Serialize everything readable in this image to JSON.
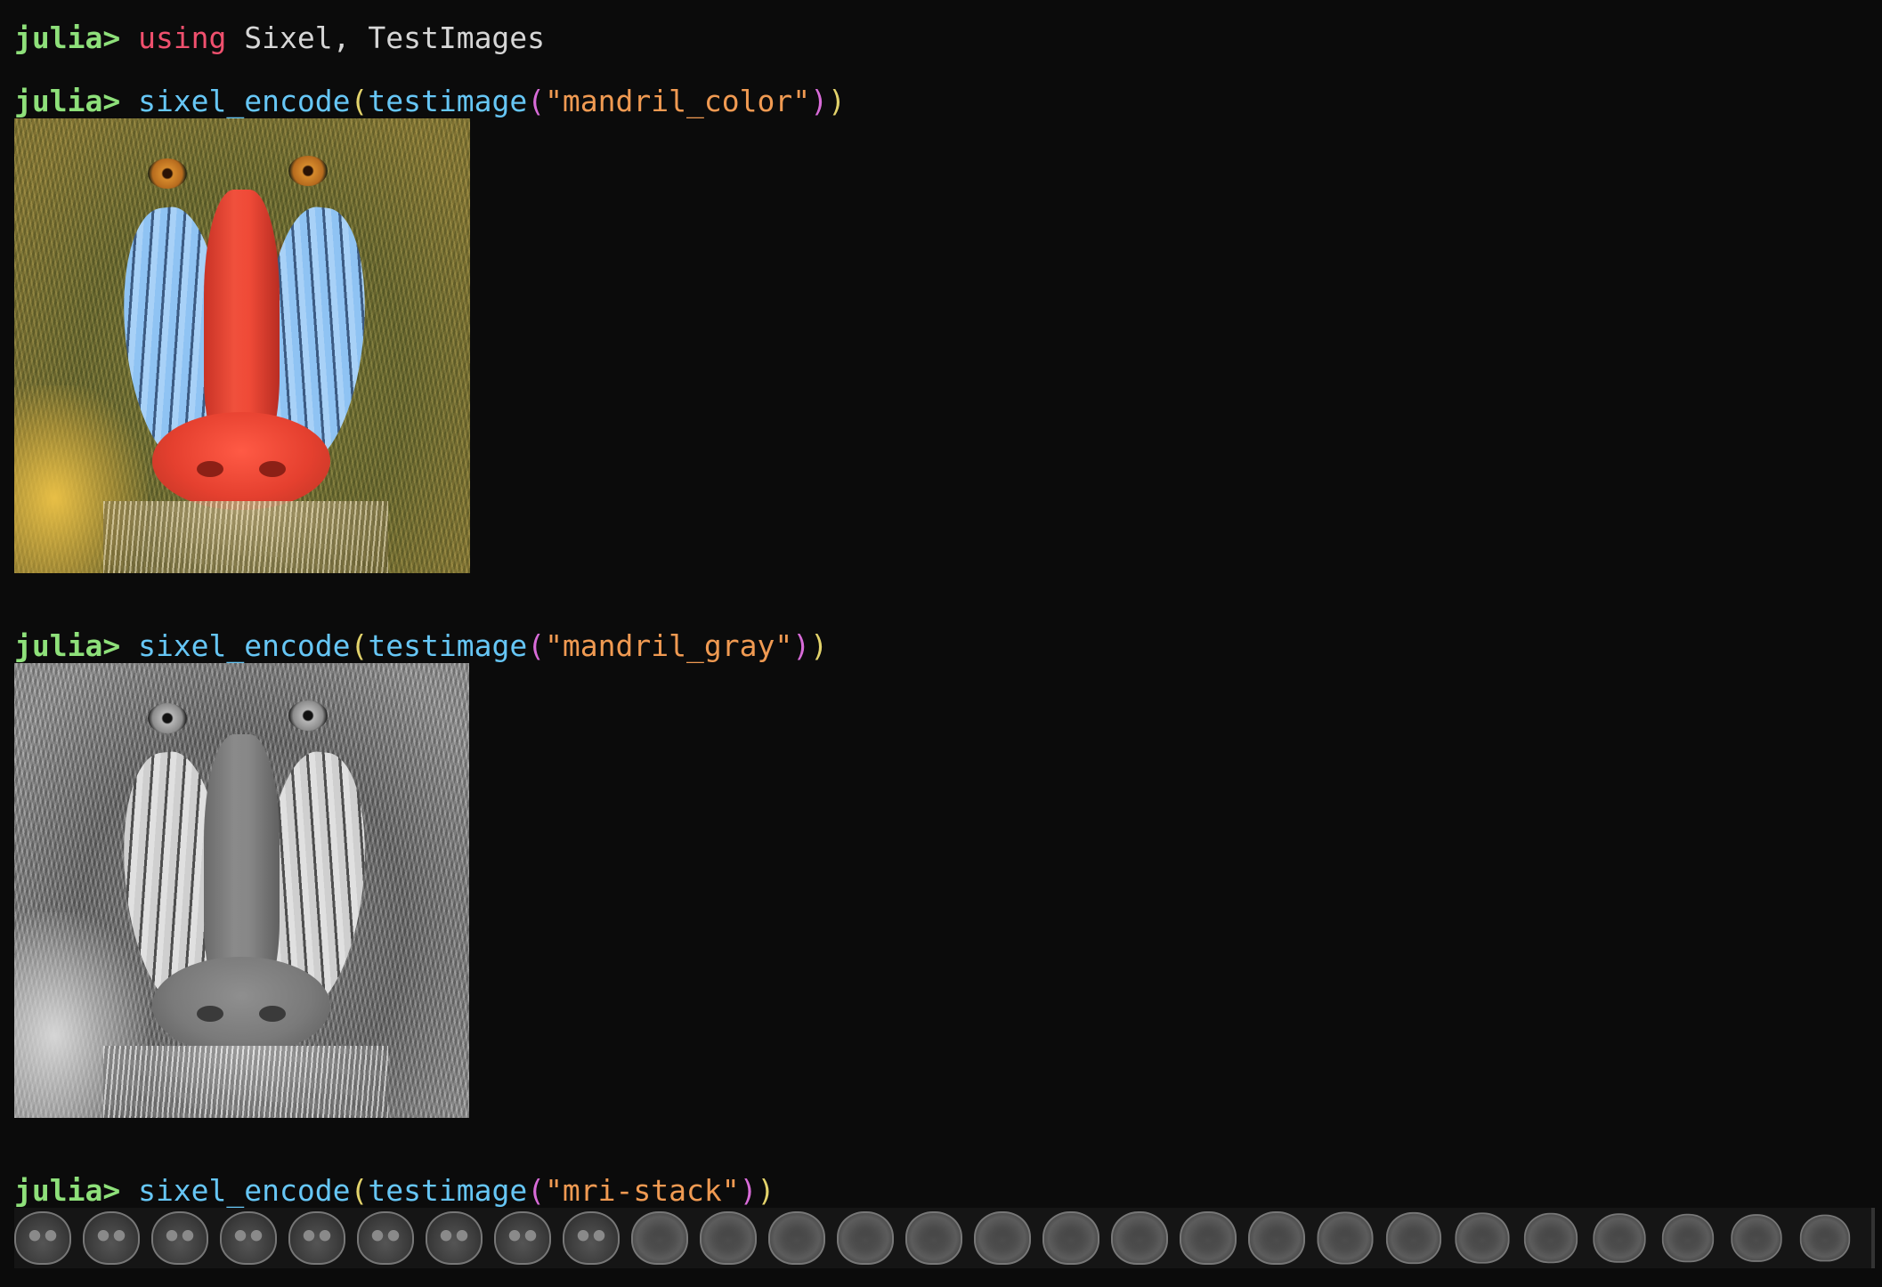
{
  "repl": {
    "prompt": "julia> ",
    "lines": [
      {
        "kw": "using",
        "rest": " Sixel, TestImages"
      },
      {
        "fn_outer": "sixel_encode",
        "paren_open_outer": "(",
        "fn_inner": "testimage",
        "paren_open_inner": "(",
        "str": "\"mandril_color\"",
        "paren_close_inner": ")",
        "paren_close_outer": ")"
      },
      {
        "fn_outer": "sixel_encode",
        "paren_open_outer": "(",
        "fn_inner": "testimage",
        "paren_open_inner": "(",
        "str": "\"mandril_gray\"",
        "paren_close_inner": ")",
        "paren_close_outer": ")"
      },
      {
        "fn_outer": "sixel_encode",
        "paren_open_outer": "(",
        "fn_inner": "testimage",
        "paren_open_inner": "(",
        "str": "\"mri-stack\"",
        "paren_close_inner": ")",
        "paren_close_outer": ")"
      }
    ]
  },
  "images": {
    "mandril_color": "mandrill-color-image",
    "mandril_gray": "mandrill-gray-image",
    "mri_stack": "mri-slice-strip"
  },
  "mri_slice_count": 27,
  "colors": {
    "background": "#0b0b0b",
    "prompt": "#8ee07a",
    "keyword": "#f0506e",
    "function": "#66c6f5",
    "string": "#f09a52",
    "paren_outer": "#e3d36b",
    "paren_inner": "#d86bd8",
    "plain": "#d6d6d6"
  }
}
